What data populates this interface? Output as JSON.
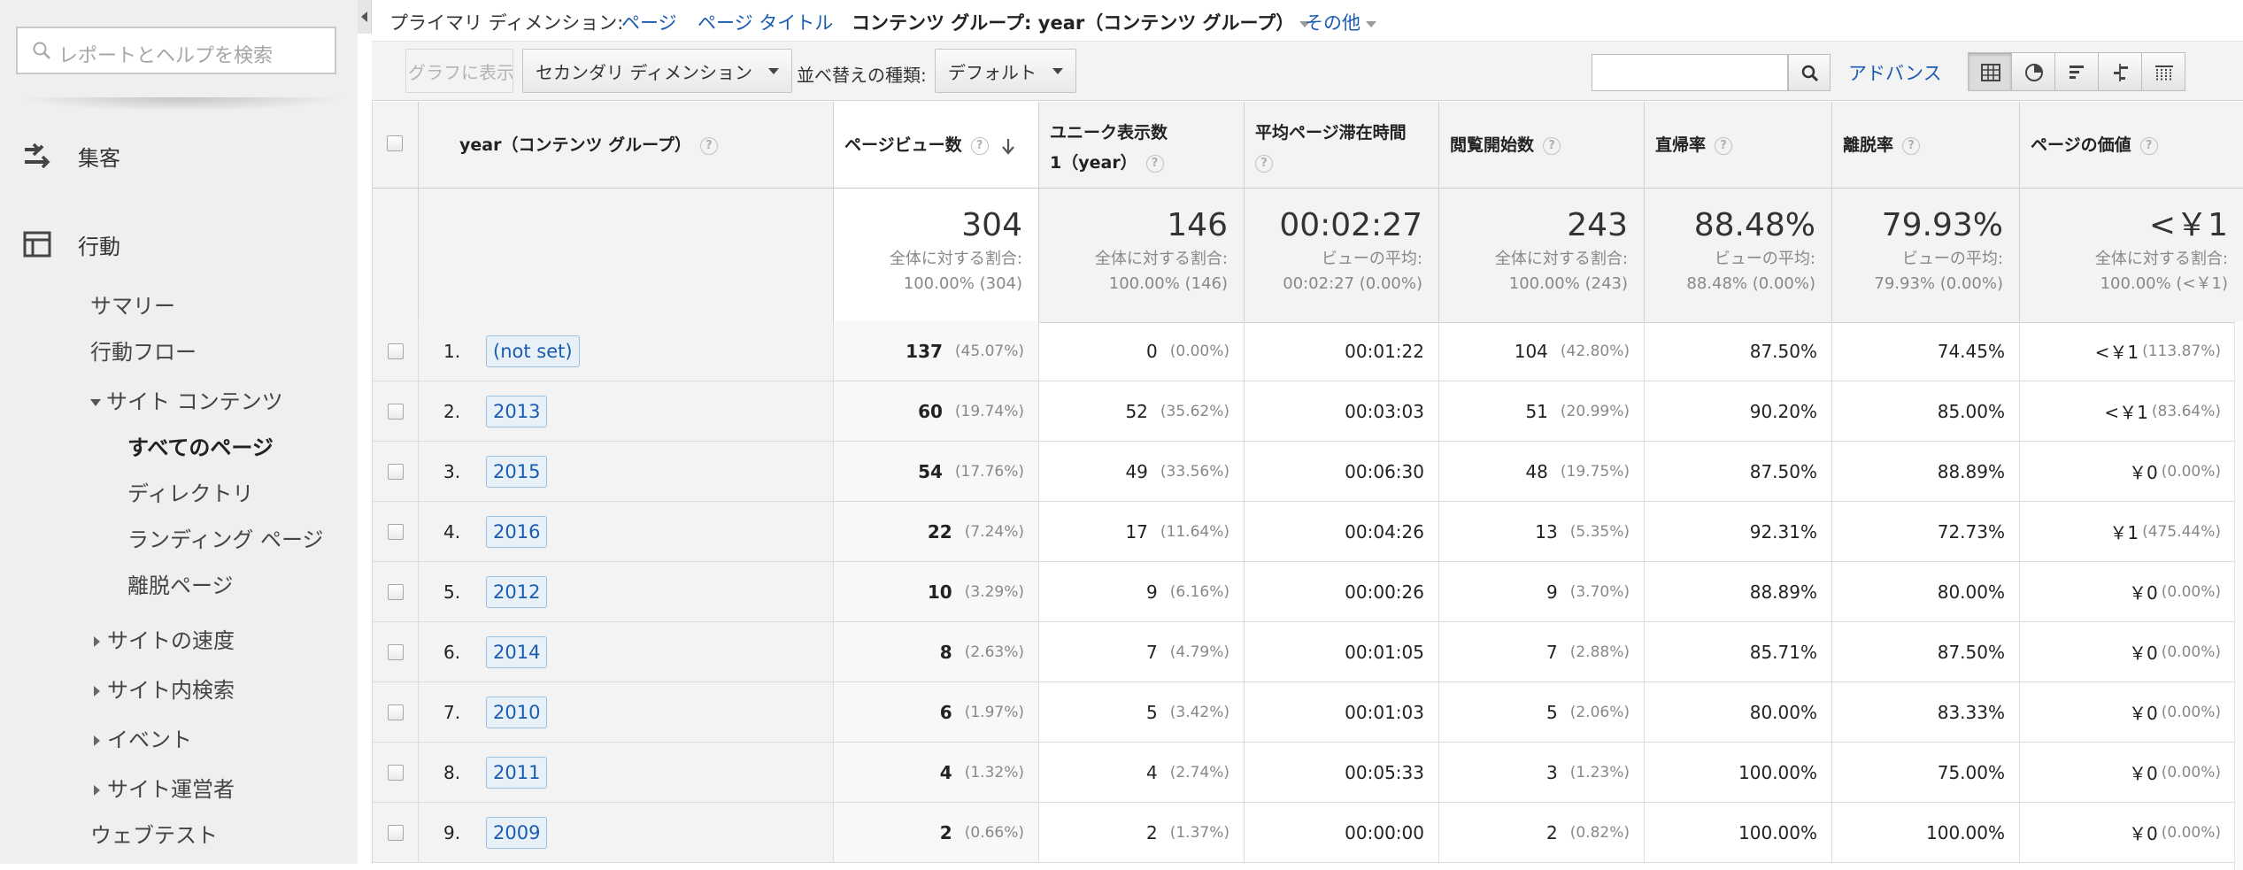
{
  "sidebar": {
    "search_placeholder": "レポートとヘルプを検索",
    "acquisition": "集客",
    "behavior": "行動",
    "items": {
      "summary": "サマリー",
      "flow": "行動フロー",
      "site_content": "サイト コンテンツ",
      "all_pages": "すべてのページ",
      "directory": "ディレクトリ",
      "landing": "ランディング ページ",
      "exit": "離脱ページ",
      "speed": "サイトの速度",
      "site_search": "サイト内検索",
      "events": "イベント",
      "publisher": "サイト運営者",
      "experiments": "ウェブテスト"
    }
  },
  "dimbar": {
    "label": "プライマリ ディメンション:",
    "page": "ページ",
    "page_title": "ページ タイトル",
    "content_group": "コンテンツ グループ: year（コンテンツ グループ）",
    "other": "その他"
  },
  "toolbar": {
    "graph_button": "グラフに表示",
    "secondary_dimension": "セカンダリ ディメンション",
    "sort_label": "並べ替えの種類:",
    "sort_value": "デフォルト",
    "advanced": "アドバンス"
  },
  "table": {
    "headers": {
      "dimension": "year（コンテンツ グループ）",
      "pageviews": "ページビュー数",
      "unique_line1": "ユニーク表示数",
      "unique_line2": "1（year）",
      "avg_time": "平均ページ滞在時間",
      "entrances": "閲覧開始数",
      "bounce": "直帰率",
      "exit": "離脱率",
      "value": "ページの価値"
    },
    "summary": {
      "pageviews": {
        "big": "304",
        "l1": "全体に対する割合:",
        "l2": "100.00% (304)"
      },
      "unique": {
        "big": "146",
        "l1": "全体に対する割合:",
        "l2": "100.00% (146)"
      },
      "avg_time": {
        "big": "00:02:27",
        "l1": "ビューの平均:",
        "l2": "00:02:27 (0.00%)"
      },
      "entrances": {
        "big": "243",
        "l1": "全体に対する割合:",
        "l2": "100.00% (243)"
      },
      "bounce": {
        "big": "88.48%",
        "l1": "ビューの平均:",
        "l2": "88.48% (0.00%)"
      },
      "exit": {
        "big": "79.93%",
        "l1": "ビューの平均:",
        "l2": "79.93% (0.00%)"
      },
      "value": {
        "big": "<￥1",
        "l1": "全体に対する割合:",
        "l2": "100.00% (<￥1)"
      }
    },
    "rows": [
      {
        "idx": "1.",
        "name": "(not set)",
        "pv": "137",
        "pv_pct": "(45.07%)",
        "uv": "0",
        "uv_pct": "(0.00%)",
        "time": "00:01:22",
        "ent": "104",
        "ent_pct": "(42.80%)",
        "bounce": "87.50%",
        "exit": "74.45%",
        "val": "<￥1",
        "val_pct": "(113.87%)"
      },
      {
        "idx": "2.",
        "name": "2013",
        "pv": "60",
        "pv_pct": "(19.74%)",
        "uv": "52",
        "uv_pct": "(35.62%)",
        "time": "00:03:03",
        "ent": "51",
        "ent_pct": "(20.99%)",
        "bounce": "90.20%",
        "exit": "85.00%",
        "val": "<￥1",
        "val_pct": "(83.64%)"
      },
      {
        "idx": "3.",
        "name": "2015",
        "pv": "54",
        "pv_pct": "(17.76%)",
        "uv": "49",
        "uv_pct": "(33.56%)",
        "time": "00:06:30",
        "ent": "48",
        "ent_pct": "(19.75%)",
        "bounce": "87.50%",
        "exit": "88.89%",
        "val": "￥0",
        "val_pct": "(0.00%)"
      },
      {
        "idx": "4.",
        "name": "2016",
        "pv": "22",
        "pv_pct": "(7.24%)",
        "uv": "17",
        "uv_pct": "(11.64%)",
        "time": "00:04:26",
        "ent": "13",
        "ent_pct": "(5.35%)",
        "bounce": "92.31%",
        "exit": "72.73%",
        "val": "￥1",
        "val_pct": "(475.44%)"
      },
      {
        "idx": "5.",
        "name": "2012",
        "pv": "10",
        "pv_pct": "(3.29%)",
        "uv": "9",
        "uv_pct": "(6.16%)",
        "time": "00:00:26",
        "ent": "9",
        "ent_pct": "(3.70%)",
        "bounce": "88.89%",
        "exit": "80.00%",
        "val": "￥0",
        "val_pct": "(0.00%)"
      },
      {
        "idx": "6.",
        "name": "2014",
        "pv": "8",
        "pv_pct": "(2.63%)",
        "uv": "7",
        "uv_pct": "(4.79%)",
        "time": "00:01:05",
        "ent": "7",
        "ent_pct": "(2.88%)",
        "bounce": "85.71%",
        "exit": "87.50%",
        "val": "￥0",
        "val_pct": "(0.00%)"
      },
      {
        "idx": "7.",
        "name": "2010",
        "pv": "6",
        "pv_pct": "(1.97%)",
        "uv": "5",
        "uv_pct": "(3.42%)",
        "time": "00:01:03",
        "ent": "5",
        "ent_pct": "(2.06%)",
        "bounce": "80.00%",
        "exit": "83.33%",
        "val": "￥0",
        "val_pct": "(0.00%)"
      },
      {
        "idx": "8.",
        "name": "2011",
        "pv": "4",
        "pv_pct": "(1.32%)",
        "uv": "4",
        "uv_pct": "(2.74%)",
        "time": "00:05:33",
        "ent": "3",
        "ent_pct": "(1.23%)",
        "bounce": "100.00%",
        "exit": "75.00%",
        "val": "￥0",
        "val_pct": "(0.00%)"
      },
      {
        "idx": "9.",
        "name": "2009",
        "pv": "2",
        "pv_pct": "(0.66%)",
        "uv": "2",
        "uv_pct": "(1.37%)",
        "time": "00:00:00",
        "ent": "2",
        "ent_pct": "(0.82%)",
        "bounce": "100.00%",
        "exit": "100.00%",
        "val": "￥0",
        "val_pct": "(0.00%)"
      }
    ]
  }
}
